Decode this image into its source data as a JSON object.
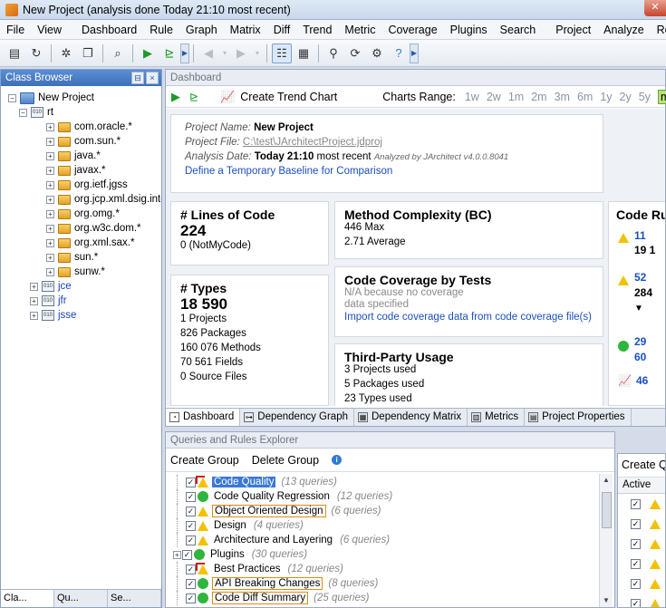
{
  "window": {
    "title": "New Project  (analysis done Today 21:10 most recent)"
  },
  "menu": [
    "File",
    "View",
    "Dashboard",
    "Rule",
    "Graph",
    "Matrix",
    "Diff",
    "Trend",
    "Metric",
    "Coverage",
    "Plugins",
    "Search",
    "Project",
    "Analyze",
    "Rep"
  ],
  "class_browser": {
    "title": "Class Browser",
    "project": "New Project",
    "assembly_rt": "rt",
    "namespaces": [
      "com.oracle.*",
      "com.sun.*",
      "java.*",
      "javax.*",
      "org.ietf.jgss",
      "org.jcp.xml.dsig.inte",
      "org.omg.*",
      "org.w3c.dom.*",
      "org.xml.sax.*",
      "sun.*",
      "sunw.*"
    ],
    "assemblies": [
      "jce",
      "jfr",
      "jsse"
    ],
    "bottom_tabs": [
      "Cla...",
      "Qu...",
      "Se..."
    ]
  },
  "dashboard": {
    "panel_title": "Dashboard",
    "create_trend_chart": "Create Trend Chart",
    "charts_range_label": "Charts Range:",
    "ranges": [
      "1w",
      "2w",
      "1m",
      "2m",
      "3m",
      "6m",
      "1y",
      "2y",
      "5y",
      "max"
    ],
    "active_range": "max",
    "project_name_label": "Project Name:",
    "project_name": "New Project",
    "project_file_label": "Project File:",
    "project_file": "C:\\test\\JArchitectProject.jdproj",
    "analysis_date_label": "Analysis Date:",
    "analysis_date": "Today 21:10",
    "analysis_date_suffix": "most recent",
    "analyzed_by": "Analyzed by JArchitect v4.0.0.8041",
    "baseline_link": "Define a Temporary Baseline for Comparison",
    "lines_of_code": {
      "title": "# Lines of Code",
      "value": "224",
      "not_my_code": "0  (NotMyCode)"
    },
    "types": {
      "title": "# Types",
      "value": "18 590",
      "rows": [
        "1   Projects",
        "826   Packages",
        "160 076   Methods",
        "70 561   Fields",
        "0   Source Files"
      ]
    },
    "method_complexity": {
      "title": "Method Complexity (BC)",
      "rows": [
        "446   Max",
        "2.71   Average"
      ]
    },
    "code_coverage": {
      "title": "Code Coverage by Tests",
      "na_line1": "N/A because no coverage",
      "na_line2": "data specified",
      "import_link": "Import code coverage data from code coverage file(s)"
    },
    "third_party": {
      "title": "Third-Party Usage",
      "rows": [
        "3   Projects used",
        "5   Packages used",
        "23   Types used"
      ]
    },
    "code_rules": {
      "title": "Code Ru",
      "items": [
        {
          "n": "11",
          "sub": "19 1"
        },
        {
          "n": "52",
          "sub": "284"
        },
        {
          "n": "29",
          "sub": "60"
        },
        {
          "n": "46",
          "sub": ""
        }
      ]
    },
    "tabs": [
      "Dashboard",
      "Dependency Graph",
      "Dependency Matrix",
      "Metrics",
      "Project Properties"
    ]
  },
  "queries": {
    "panel_title": "Queries and Rules Explorer",
    "create_group": "Create Group",
    "delete_group": "Delete Group",
    "groups": [
      {
        "name": "Code Quality",
        "count": "(13 queries)",
        "status": "warn-critical",
        "style": "selected"
      },
      {
        "name": "Code Quality Regression",
        "count": "(12 queries)",
        "status": "ok",
        "style": ""
      },
      {
        "name": "Object Oriented Design",
        "count": "(6 queries)",
        "status": "warn",
        "style": "boxed"
      },
      {
        "name": "Design",
        "count": "(4 queries)",
        "status": "warn",
        "style": ""
      },
      {
        "name": "Architecture and Layering",
        "count": "(6 queries)",
        "status": "warn",
        "style": ""
      },
      {
        "name": "Plugins",
        "count": "(30 queries)",
        "status": "ok",
        "style": ""
      },
      {
        "name": "Best Practices",
        "count": "(12 queries)",
        "status": "warn-critical",
        "style": ""
      },
      {
        "name": "API Breaking Changes",
        "count": "(8 queries)",
        "status": "ok",
        "style": "boxed"
      },
      {
        "name": "Code Diff Summary",
        "count": "(25 queries)",
        "status": "ok",
        "style": "boxed"
      }
    ]
  },
  "right_panel": {
    "title": "Create Qu",
    "column": "Active"
  }
}
